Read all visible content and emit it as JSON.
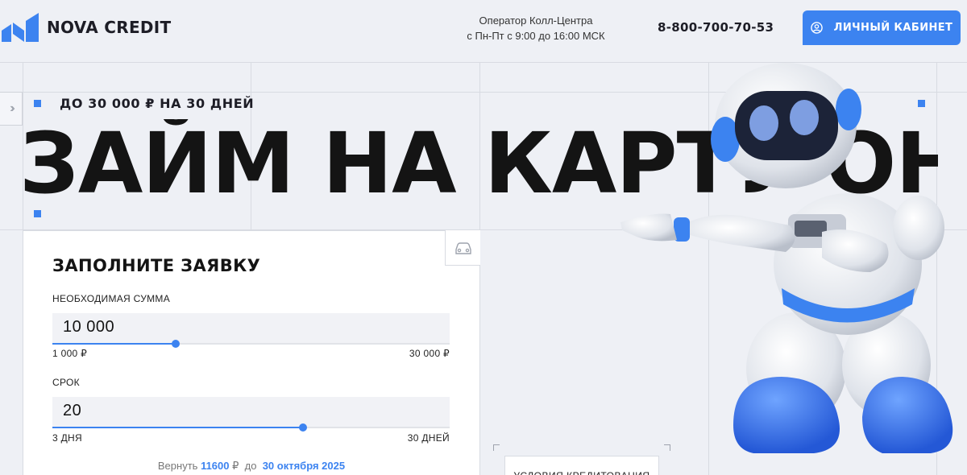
{
  "header": {
    "logo_text": "NOVA CREDIT",
    "callcenter_line1": "Оператор Колл-Центра",
    "callcenter_line2": "с Пн-Пт с 9:00 до 16:00 МСК",
    "phone": "8-800-700-70-53",
    "cabinet_label": "ЛИЧНЫЙ КАБИНЕТ"
  },
  "hero": {
    "eyebrow": "ДО 30 000 ₽ НА 30 ДНЕЙ",
    "title": "ЗАЙМ НА КАРТУ ОНЛ"
  },
  "form": {
    "title": "ЗАПОЛНИТЕ ЗАЯВКУ",
    "amount": {
      "label": "НЕОБХОДИМАЯ СУММА",
      "value": "10 000",
      "min": "1 000 ₽",
      "max": "30 000 ₽",
      "fraction": 0.31
    },
    "term": {
      "label": "СРОК",
      "value": "20",
      "min": "3 ДНЯ",
      "max": "30 ДНЕЙ",
      "fraction": 0.63
    },
    "repay_prefix": "Вернуть",
    "repay_amount": "11600",
    "repay_currency": "₽",
    "repay_until": "до",
    "repay_date": "30 октября 2025"
  },
  "conditions_label": "УСЛОВИЯ КРЕДИТОВАНИЯ",
  "colors": {
    "accent": "#3c83f0",
    "background": "#eef0f5",
    "text": "#141414"
  },
  "icons": {
    "side_toggle": "double-chevron-right-icon",
    "cabinet": "user-circle-icon",
    "corner": "car-icon"
  }
}
